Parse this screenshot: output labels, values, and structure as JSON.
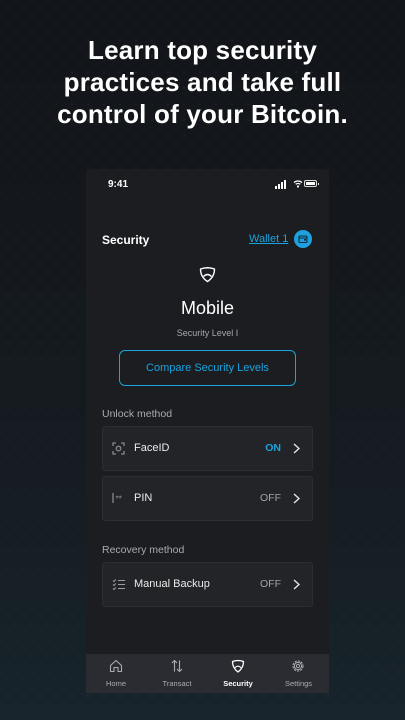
{
  "headline": "Learn top security\npractices and take full\ncontrol of your Bitcoin.",
  "status_bar": {
    "time": "9:41"
  },
  "header": {
    "title": "Security",
    "wallet_label": "Wallet 1"
  },
  "hero": {
    "icon": "shield-icon",
    "level_name": "Mobile",
    "level_subtitle": "Security Level I",
    "compare_button": "Compare Security Levels"
  },
  "unlock": {
    "section_label": "Unlock method",
    "items": [
      {
        "icon": "face-id-icon",
        "label": "FaceID",
        "status": "ON"
      },
      {
        "icon": "pin-icon",
        "label": "PIN",
        "status": "OFF"
      }
    ]
  },
  "recovery": {
    "section_label": "Recovery method",
    "items": [
      {
        "icon": "checklist-icon",
        "label": "Manual Backup",
        "status": "OFF"
      }
    ]
  },
  "tabbar": {
    "active": "Security",
    "items": [
      {
        "icon": "home-icon",
        "label": "Home"
      },
      {
        "icon": "transact-icon",
        "label": "Transact"
      },
      {
        "icon": "shield-icon",
        "label": "Security"
      },
      {
        "icon": "gear-icon",
        "label": "Settings"
      }
    ]
  },
  "colors": {
    "accent": "#1ba3de",
    "background": "#111419",
    "phone_bg": "#1b1d21",
    "card_bg": "#222428"
  }
}
